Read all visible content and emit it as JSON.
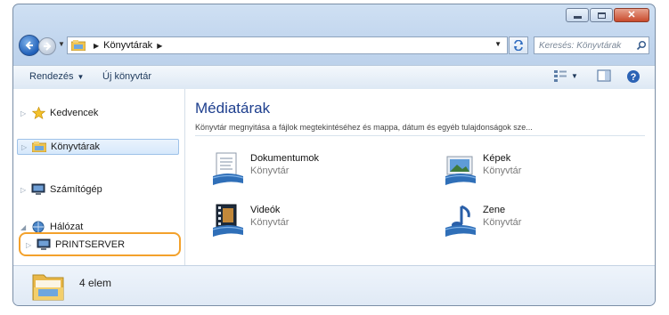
{
  "address": {
    "crumbs": [
      "Könyvtárak"
    ],
    "search_placeholder": "Keresés: Könyvtárak"
  },
  "toolbar": {
    "organize_label": "Rendezés",
    "new_library_label": "Új könyvtár"
  },
  "navpane": {
    "items": [
      {
        "label": "Kedvencek"
      },
      {
        "label": "Könyvtárak"
      },
      {
        "label": "Számítógép"
      },
      {
        "label": "Hálózat"
      },
      {
        "label": "PRINTSERVER"
      }
    ]
  },
  "content": {
    "title": "Médiatárak",
    "description": "Könyvtár megnyitása a fájlok megtekintéséhez és mappa, dátum és egyéb tulajdonságok sze...",
    "libraries": [
      {
        "name": "Dokumentumok",
        "type": "Könyvtár"
      },
      {
        "name": "Képek",
        "type": "Könyvtár"
      },
      {
        "name": "Videók",
        "type": "Könyvtár"
      },
      {
        "name": "Zene",
        "type": "Könyvtár"
      }
    ]
  },
  "details": {
    "count": "4 elem"
  },
  "colors": {
    "highlight": "#f3a12b",
    "title": "#1e3f8e"
  }
}
